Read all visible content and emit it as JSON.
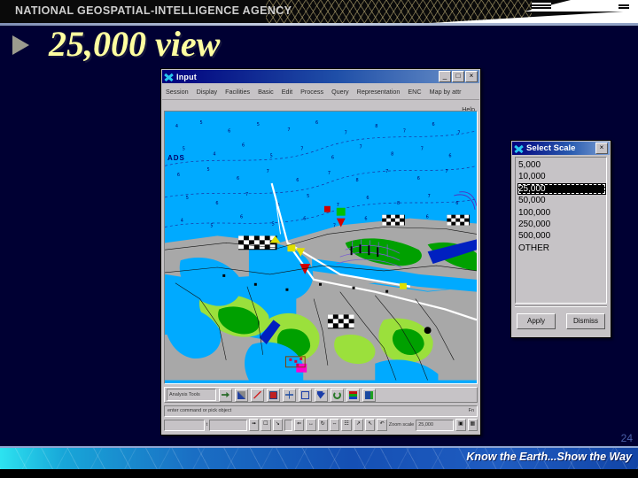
{
  "header": {
    "agency": "NATIONAL GEOSPATIAL-INTELLIGENCE AGENCY",
    "mesh_icon": "crosshatch-mesh",
    "swoosh_icon": "white-swoosh"
  },
  "slide": {
    "bullet_icon": "triangle-bullet",
    "title": "25,000 view",
    "page_number": "24",
    "background_color": "#000033",
    "title_color": "#ffffa0"
  },
  "app_window": {
    "title": "Input",
    "logo_icon": "x-window-icon",
    "window_buttons": [
      {
        "label": "_",
        "name": "minimize"
      },
      {
        "label": "□",
        "name": "maximize"
      },
      {
        "label": "×",
        "name": "close"
      }
    ],
    "menu": [
      "Session",
      "Display",
      "Facilities",
      "Basic",
      "Edit",
      "Process",
      "Query",
      "Representation",
      "ENC",
      "Map by attr"
    ],
    "help_label": "Help",
    "map": {
      "label": "ADS",
      "type": "enc-nautical-chart",
      "water_color": "#00aaff",
      "land_color": "#a8a8a8",
      "green_color": "#00a000"
    },
    "toolbar": {
      "combo_value": "Analysis Tools",
      "icons": [
        "arrow-right-icon",
        "pencil-edit-icon",
        "line-draw-icon",
        "label-icon",
        "snap-icon",
        "select-box-icon",
        "pointer-arrow-icon",
        "refresh-icon",
        "layers-icon",
        "export-icon"
      ]
    },
    "status_bar": {
      "text": "enter command or pick object",
      "right": "Fn"
    },
    "bottom_bar": {
      "left_field_value": "",
      "t_label": "t",
      "command_value": "",
      "zoom_scale_label": "Zoom scale",
      "zoom_scale_value": "25,000",
      "icons": [
        "pan-icon",
        "zoom-window-icon",
        "zoom-out-icon",
        "prev-view-icon",
        "next-view-icon",
        "redraw-icon",
        "fit-icon",
        "grid-icon",
        "measure-icon",
        "pointer-icon",
        "rotate-icon",
        "fullview-icon",
        "grid-toggle-icon"
      ]
    }
  },
  "select_scale_dialog": {
    "title": "Select Scale",
    "logo_icon": "x-window-icon",
    "close_label": "×",
    "options": [
      "5,000",
      "10,000",
      "25,000",
      "50,000",
      "100,000",
      "250,000",
      "500,000",
      "OTHER"
    ],
    "selected": "25,000",
    "buttons": [
      {
        "label": "Apply",
        "name": "apply-button"
      },
      {
        "label": "Dismiss",
        "name": "dismiss-button"
      }
    ]
  },
  "footer": {
    "tagline": "Know the Earth...Show the Way"
  }
}
